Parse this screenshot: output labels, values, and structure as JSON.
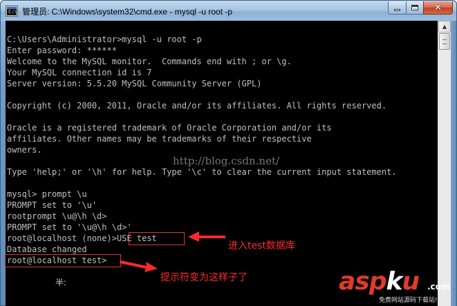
{
  "window": {
    "title": "管理员: C:\\Windows\\system32\\cmd.exe - mysql  -u root -p",
    "icon_text": "C:\\_",
    "minimize_icon": "minimize-icon",
    "maximize_icon": "maximize-icon",
    "close_glyph": "✕"
  },
  "console": {
    "lines": [
      "C:\\Users\\Administrator>mysql -u root -p",
      "Enter password: ******",
      "Welcome to the MySQL monitor.  Commands end with ; or \\g.",
      "Your MySQL connection id is 7",
      "Server version: 5.5.20 MySQL Community Server (GPL)",
      "",
      "Copyright (c) 2000, 2011, Oracle and/or its affiliates. All rights reserved.",
      "",
      "Oracle is a registered trademark of Oracle Corporation and/or its",
      "affiliates. Other names may be trademarks of their respective",
      "owners.",
      "",
      "Type 'help;' or '\\h' for help. Type '\\c' to clear the current input statement.",
      "",
      "mysql> prompt \\u",
      "PROMPT set to '\\u'",
      "rootprompt \\u@\\h \\d>",
      "PROMPT set to '\\u@\\h \\d>'",
      "root@localhost (none)>USE test",
      "Database changed",
      "root@localhost test>"
    ],
    "trailing_fragment": "半:"
  },
  "scrollbar": {
    "up_arrow": "▲"
  },
  "annotations": {
    "use_test_label": "进入test数据库",
    "prompt_changed_label": "提示符变为这样子了",
    "color": "#ff2a2a"
  },
  "watermark": {
    "url": "http://blog.csdn.net/"
  },
  "logo": {
    "part1": "asp",
    "part2": "k",
    "part3": "u",
    "suffix": ".com",
    "tagline": "免费网站源码下载站!"
  }
}
